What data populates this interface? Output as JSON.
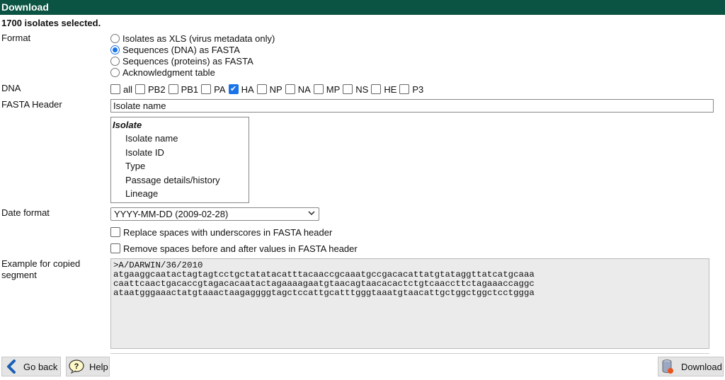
{
  "window": {
    "title": "Download"
  },
  "selection_summary": "1700 isolates selected.",
  "format": {
    "label": "Format",
    "options": [
      {
        "label": "Isolates as XLS (virus metadata only)",
        "selected": false
      },
      {
        "label": "Sequences (DNA) as FASTA",
        "selected": true
      },
      {
        "label": "Sequences (proteins) as FASTA",
        "selected": false
      },
      {
        "label": "Acknowledgment table",
        "selected": false
      }
    ]
  },
  "dna": {
    "label": "DNA",
    "segments": [
      {
        "label": "all",
        "checked": false
      },
      {
        "label": "PB2",
        "checked": false
      },
      {
        "label": "PB1",
        "checked": false
      },
      {
        "label": "PA",
        "checked": false
      },
      {
        "label": "HA",
        "checked": true
      },
      {
        "label": "NP",
        "checked": false
      },
      {
        "label": "NA",
        "checked": false
      },
      {
        "label": "MP",
        "checked": false
      },
      {
        "label": "NS",
        "checked": false
      },
      {
        "label": "HE",
        "checked": false
      },
      {
        "label": "P3",
        "checked": false
      }
    ]
  },
  "fasta_header": {
    "label": "FASTA Header",
    "value": "Isolate name",
    "list": {
      "group": "Isolate",
      "options": [
        "Isolate name",
        "Isolate ID",
        "Type",
        "Passage details/history",
        "Lineage"
      ]
    }
  },
  "date_format": {
    "label": "Date format",
    "selected": "YYYY-MM-DD (2009-02-28)"
  },
  "options": {
    "replace_spaces": {
      "label": "Replace spaces with underscores in FASTA header",
      "checked": false
    },
    "remove_spaces": {
      "label": "Remove spaces before and after values in FASTA header",
      "checked": false
    }
  },
  "example": {
    "label_line1": "Example for copied",
    "label_line2": "segment",
    "text": ">A/DARWIN/36/2010\natgaaggcaatactagtagtcctgctatatacatttacaaccgcaaatgccgacacattatgtataggttatcatgcaaa\ncaattcaactgacaccgtagacacaatactagaaaagaatgtaacagtaacacactctgtcaaccttctagaaaccaggc\nataatgggaaactatgtaaactaagaggggtagctccattgcatttgggtaaatgtaacattgctggctggctcctggga"
  },
  "footer": {
    "go_back": "Go back",
    "help": "Help",
    "download": "Download"
  },
  "colors": {
    "titlebar": "#0b5342",
    "accent": "#1a73e8"
  }
}
